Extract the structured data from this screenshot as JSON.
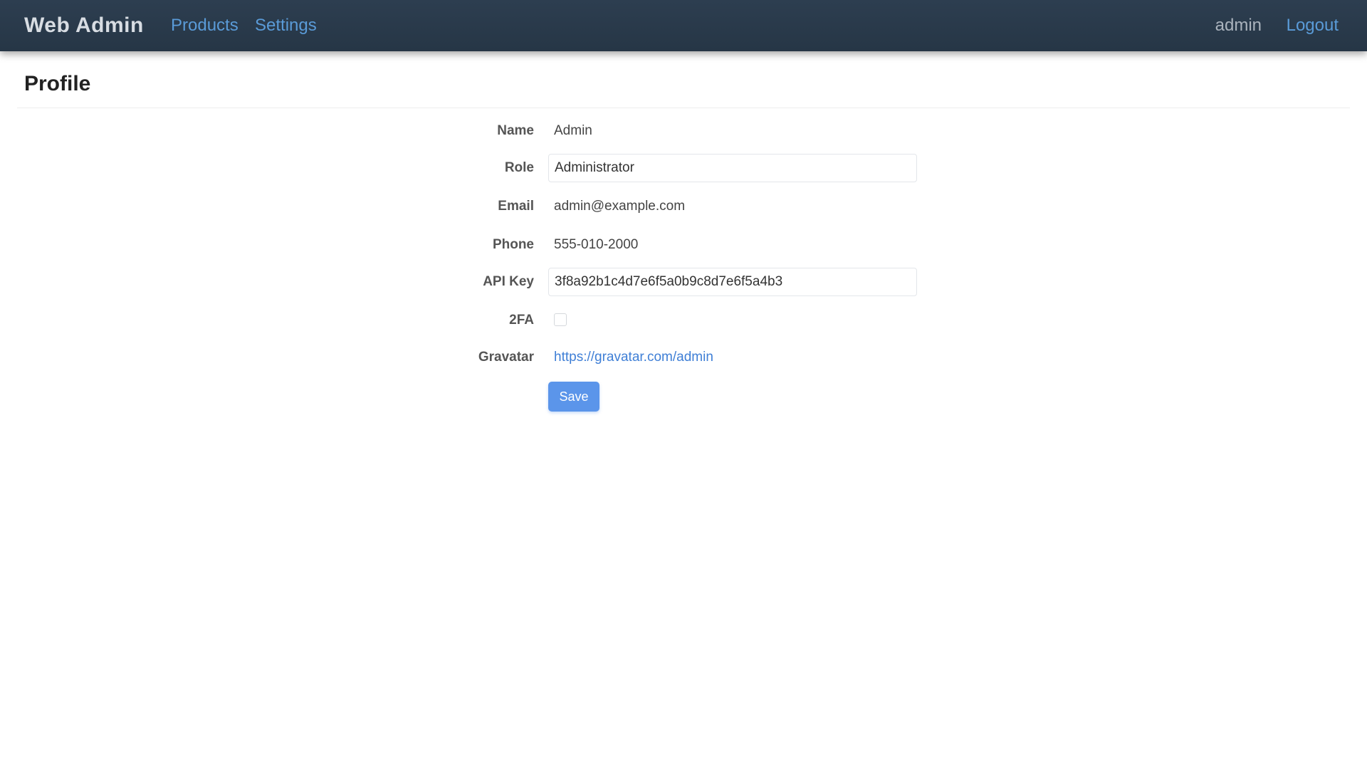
{
  "navbar": {
    "brand": "Web Admin",
    "links": [
      "Products",
      "Settings"
    ],
    "user": "admin",
    "logout": "Logout"
  },
  "page": {
    "title": "Profile"
  },
  "form": {
    "fields": [
      {
        "label": "Name",
        "value": "Admin"
      },
      {
        "label": "Role",
        "value": "Administrator"
      },
      {
        "label": "Email",
        "value": "admin@example.com"
      },
      {
        "label": "Phone",
        "value": "555-010-2000"
      },
      {
        "label": "API Key",
        "value": "3f8a92b1c4d7e6f5a0b9c8d7e6f5a4b3"
      },
      {
        "label": "2FA",
        "value": ""
      },
      {
        "label": "Gravatar",
        "value": "https://gravatar.com/admin"
      }
    ],
    "submit_label": "Save"
  }
}
